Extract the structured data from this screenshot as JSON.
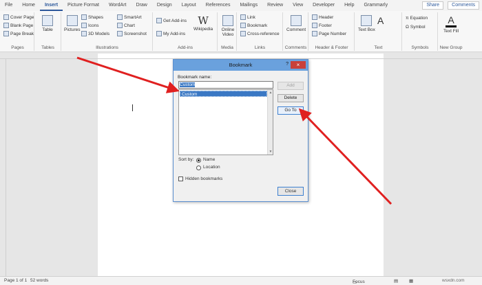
{
  "tabs": [
    "File",
    "Home",
    "Insert",
    "Picture Format",
    "WordArt",
    "Draw",
    "Design",
    "Layout",
    "References",
    "Mailings",
    "Review",
    "View",
    "Developer",
    "Help",
    "Grammarly"
  ],
  "share_label": "Share",
  "comments_label": "Comments",
  "ribbon": {
    "pages": {
      "label": "Pages",
      "items": [
        "Cover Page",
        "Blank Page",
        "Page Break"
      ]
    },
    "tables": {
      "label": "Tables",
      "table": "Table"
    },
    "illustrations": {
      "label": "Illustrations",
      "pictures": "Pictures",
      "items": [
        "Shapes",
        "Icons",
        "3D Models"
      ],
      "items2": [
        "SmartArt",
        "Chart",
        "Screenshot"
      ]
    },
    "addins": {
      "label": "Add-ins",
      "get": "Get Add-ins",
      "my": "My Add-ins",
      "wikipedia": "Wikipedia"
    },
    "media": {
      "label": "Media",
      "online_video": "Online Video"
    },
    "links": {
      "label": "Links",
      "items": [
        "Link",
        "Bookmark",
        "Cross-reference"
      ]
    },
    "comments": {
      "label": "Comments",
      "comment": "Comment"
    },
    "header_footer": {
      "label": "Header & Footer",
      "items": [
        "Header",
        "Footer",
        "Page Number"
      ]
    },
    "text": {
      "label": "Text",
      "text_box": "Text Box",
      "item": "A"
    },
    "symbols": {
      "label": "Symbols",
      "items": [
        "Equation",
        "Symbol"
      ]
    },
    "new_group": {
      "label": "New Group",
      "text_fill": "Text Fill"
    }
  },
  "dialog": {
    "title": "Bookmark",
    "help": "?",
    "close_x": "×",
    "name_label": "Bookmark name:",
    "name_value": "Custom",
    "list_items": [
      "Custom"
    ],
    "add": "Add",
    "delete": "Delete",
    "goto": "Go To",
    "sort_by": "Sort by:",
    "sort_name": "Name",
    "sort_location": "Location",
    "hidden": "Hidden bookmarks",
    "close": "Close"
  },
  "status": {
    "page": "Page 1 of 1",
    "words": "52 words",
    "focus": "Focus",
    "watermark": "wsxdn.com"
  },
  "colors": {
    "accent": "#2b579a",
    "arrow": "#e02020",
    "dialog_title": "#6aa1dd"
  }
}
